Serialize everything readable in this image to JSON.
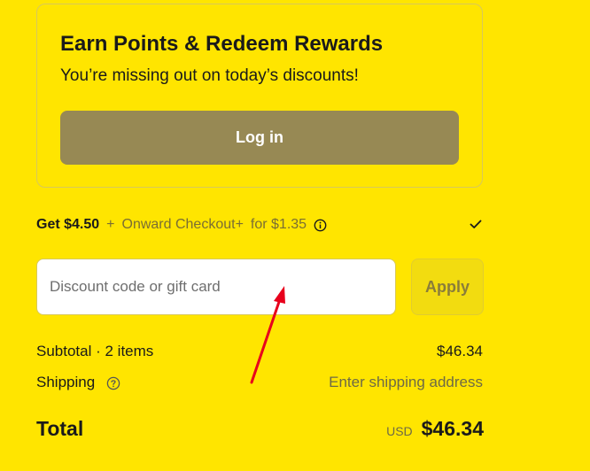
{
  "rewards": {
    "title": "Earn Points & Redeem Rewards",
    "subtitle": "You’re missing out on today’s discounts!",
    "login_label": "Log in"
  },
  "onward": {
    "get_label": "Get $4.50",
    "plus": "+",
    "product": "Onward Checkout+",
    "price_text": "for $1.35",
    "checked": true
  },
  "discount": {
    "placeholder": "Discount code or gift card",
    "apply_label": "Apply"
  },
  "summary": {
    "subtotal_label": "Subtotal · 2 items",
    "subtotal_value": "$46.34",
    "shipping_label": "Shipping",
    "shipping_value": "Enter shipping address",
    "total_label": "Total",
    "currency": "USD",
    "total_value": "$46.34"
  },
  "colors": {
    "background": "#FFE500",
    "login_button": "#978954",
    "annotation_arrow": "#E8001C"
  },
  "icons": [
    "info-icon",
    "checkmark-icon",
    "help-icon"
  ]
}
